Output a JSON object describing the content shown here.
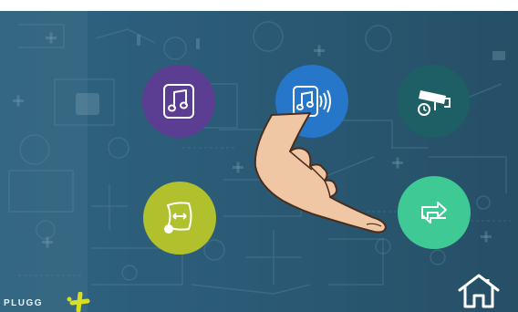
{
  "screen": {
    "background_color": "#2a5f7c",
    "apps": [
      {
        "name": "music",
        "icon": "music-note-icon",
        "color": "#5b3e91"
      },
      {
        "name": "music-stream",
        "icon": "music-note-sound-icon",
        "color": "#2676c9"
      },
      {
        "name": "cctv",
        "icon": "security-camera-icon",
        "color": "#1d5f64"
      },
      {
        "name": "intercom",
        "icon": "door-phone-icon",
        "color": "#b1c12d"
      },
      {
        "name": "sync",
        "icon": "sync-icon",
        "color": "#3fca95"
      }
    ],
    "home_icon": "home-icon",
    "overlay": "pointing-hand-illustration"
  },
  "brand": {
    "logo_text": "PLUGG",
    "logo_accent_color": "#d7df23"
  }
}
